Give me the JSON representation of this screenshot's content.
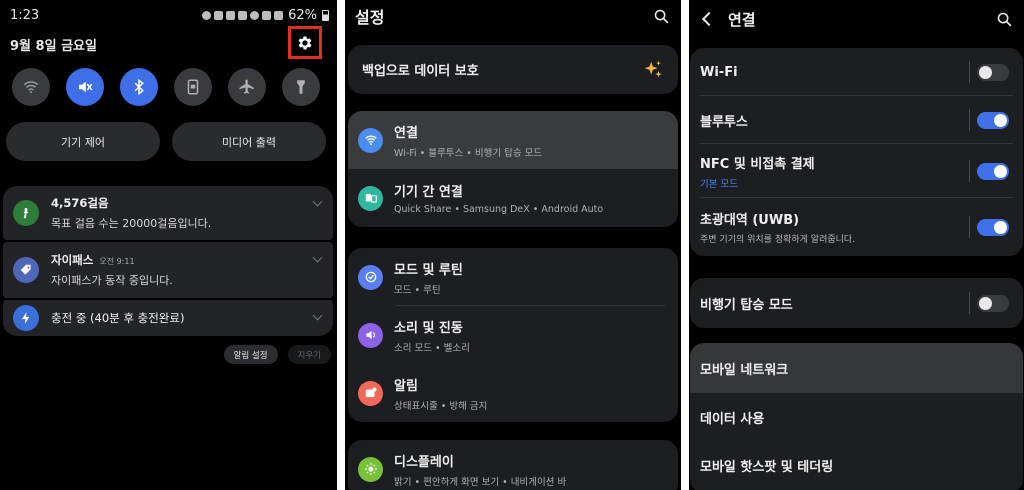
{
  "quick_panel": {
    "time": "1:23",
    "battery": "62%",
    "date": "9월 8일 금요일",
    "settings_icon": "gear-icon",
    "tiles": [
      {
        "name": "wifi",
        "icon": "wifi-icon",
        "on": false
      },
      {
        "name": "sound-mute",
        "icon": "mute-icon",
        "on": true
      },
      {
        "name": "bluetooth",
        "icon": "bluetooth-icon",
        "on": true
      },
      {
        "name": "portrait",
        "icon": "screen-lock-icon",
        "on": false
      },
      {
        "name": "airplane",
        "icon": "airplane-icon",
        "on": false
      },
      {
        "name": "flashlight",
        "icon": "flashlight-icon",
        "on": false
      }
    ],
    "device_control": "기기 제어",
    "media_output": "미디어 출력",
    "notifications": [
      {
        "title": "4,576걸음",
        "time": "",
        "text": "목표 걸음 수는 20000걸음입니다.",
        "icon": "steps-icon",
        "color": "#2f7d3a"
      },
      {
        "title": "자이패스",
        "time": "오전 9:11",
        "text": "자이패스가 동작 중입니다.",
        "icon": "tag-icon",
        "color": "#4f67b8"
      },
      {
        "title": "충전 중 (40분 후 충전완료)",
        "time": "",
        "text": "",
        "icon": "charging-icon",
        "color": "#3a6fd8"
      }
    ],
    "notif_settings": "알림 설정",
    "clear_all": "지우기"
  },
  "settings": {
    "title": "설정",
    "backup": "백업으로 데이터 보호",
    "groups": [
      [
        {
          "label": "연결",
          "sub": "Wi-Fi  •  블루투스  •  비행기 탑승 모드",
          "icon": "wifi-icon",
          "color": "#4a8cf0"
        },
        {
          "label": "기기 간 연결",
          "sub": "Quick Share  •  Samsung DeX  •  Android Auto",
          "icon": "devices-icon",
          "color": "#2fb7a0"
        }
      ],
      [
        {
          "label": "모드 및 루틴",
          "sub": "모드  •  루틴",
          "icon": "check-circle-icon",
          "color": "#5b7ff0"
        },
        {
          "label": "소리 및 진동",
          "sub": "소리 모드  •  벨소리",
          "icon": "volume-icon",
          "color": "#8b62e8"
        },
        {
          "label": "알림",
          "sub": "상태표시줄  •  방해 금지",
          "icon": "notification-icon",
          "color": "#f06a5a"
        }
      ],
      [
        {
          "label": "디스플레이",
          "sub": "밝기  •  편안하게 화면 보기  •  내비게이션 바",
          "icon": "brightness-icon",
          "color": "#78c23a"
        }
      ]
    ]
  },
  "connections": {
    "title": "연결",
    "rows": [
      {
        "label": "Wi-Fi",
        "sub": "",
        "toggle": false
      },
      {
        "label": "블루투스",
        "sub": "",
        "toggle": true
      },
      {
        "label": "NFC 및 비접촉 결제",
        "sub": "기본 모드",
        "toggle": true
      },
      {
        "label": "초광대역 (UWB)",
        "sub": "주변 기기의 위치를 정확하게 알려줍니다.",
        "toggle": true
      },
      {
        "label": "비행기 탑승 모드",
        "sub": "",
        "toggle": false
      },
      {
        "label": "모바일 네트워크",
        "sub": "",
        "toggle": null
      },
      {
        "label": "데이터 사용",
        "sub": "",
        "toggle": null
      },
      {
        "label": "모바일 핫스팟 및 테더링",
        "sub": "",
        "toggle": null
      }
    ]
  },
  "colors": {
    "accent": "#3f72ea",
    "highlight_box": "#e0301e",
    "background": "#000000",
    "card": "#1d1e21"
  }
}
